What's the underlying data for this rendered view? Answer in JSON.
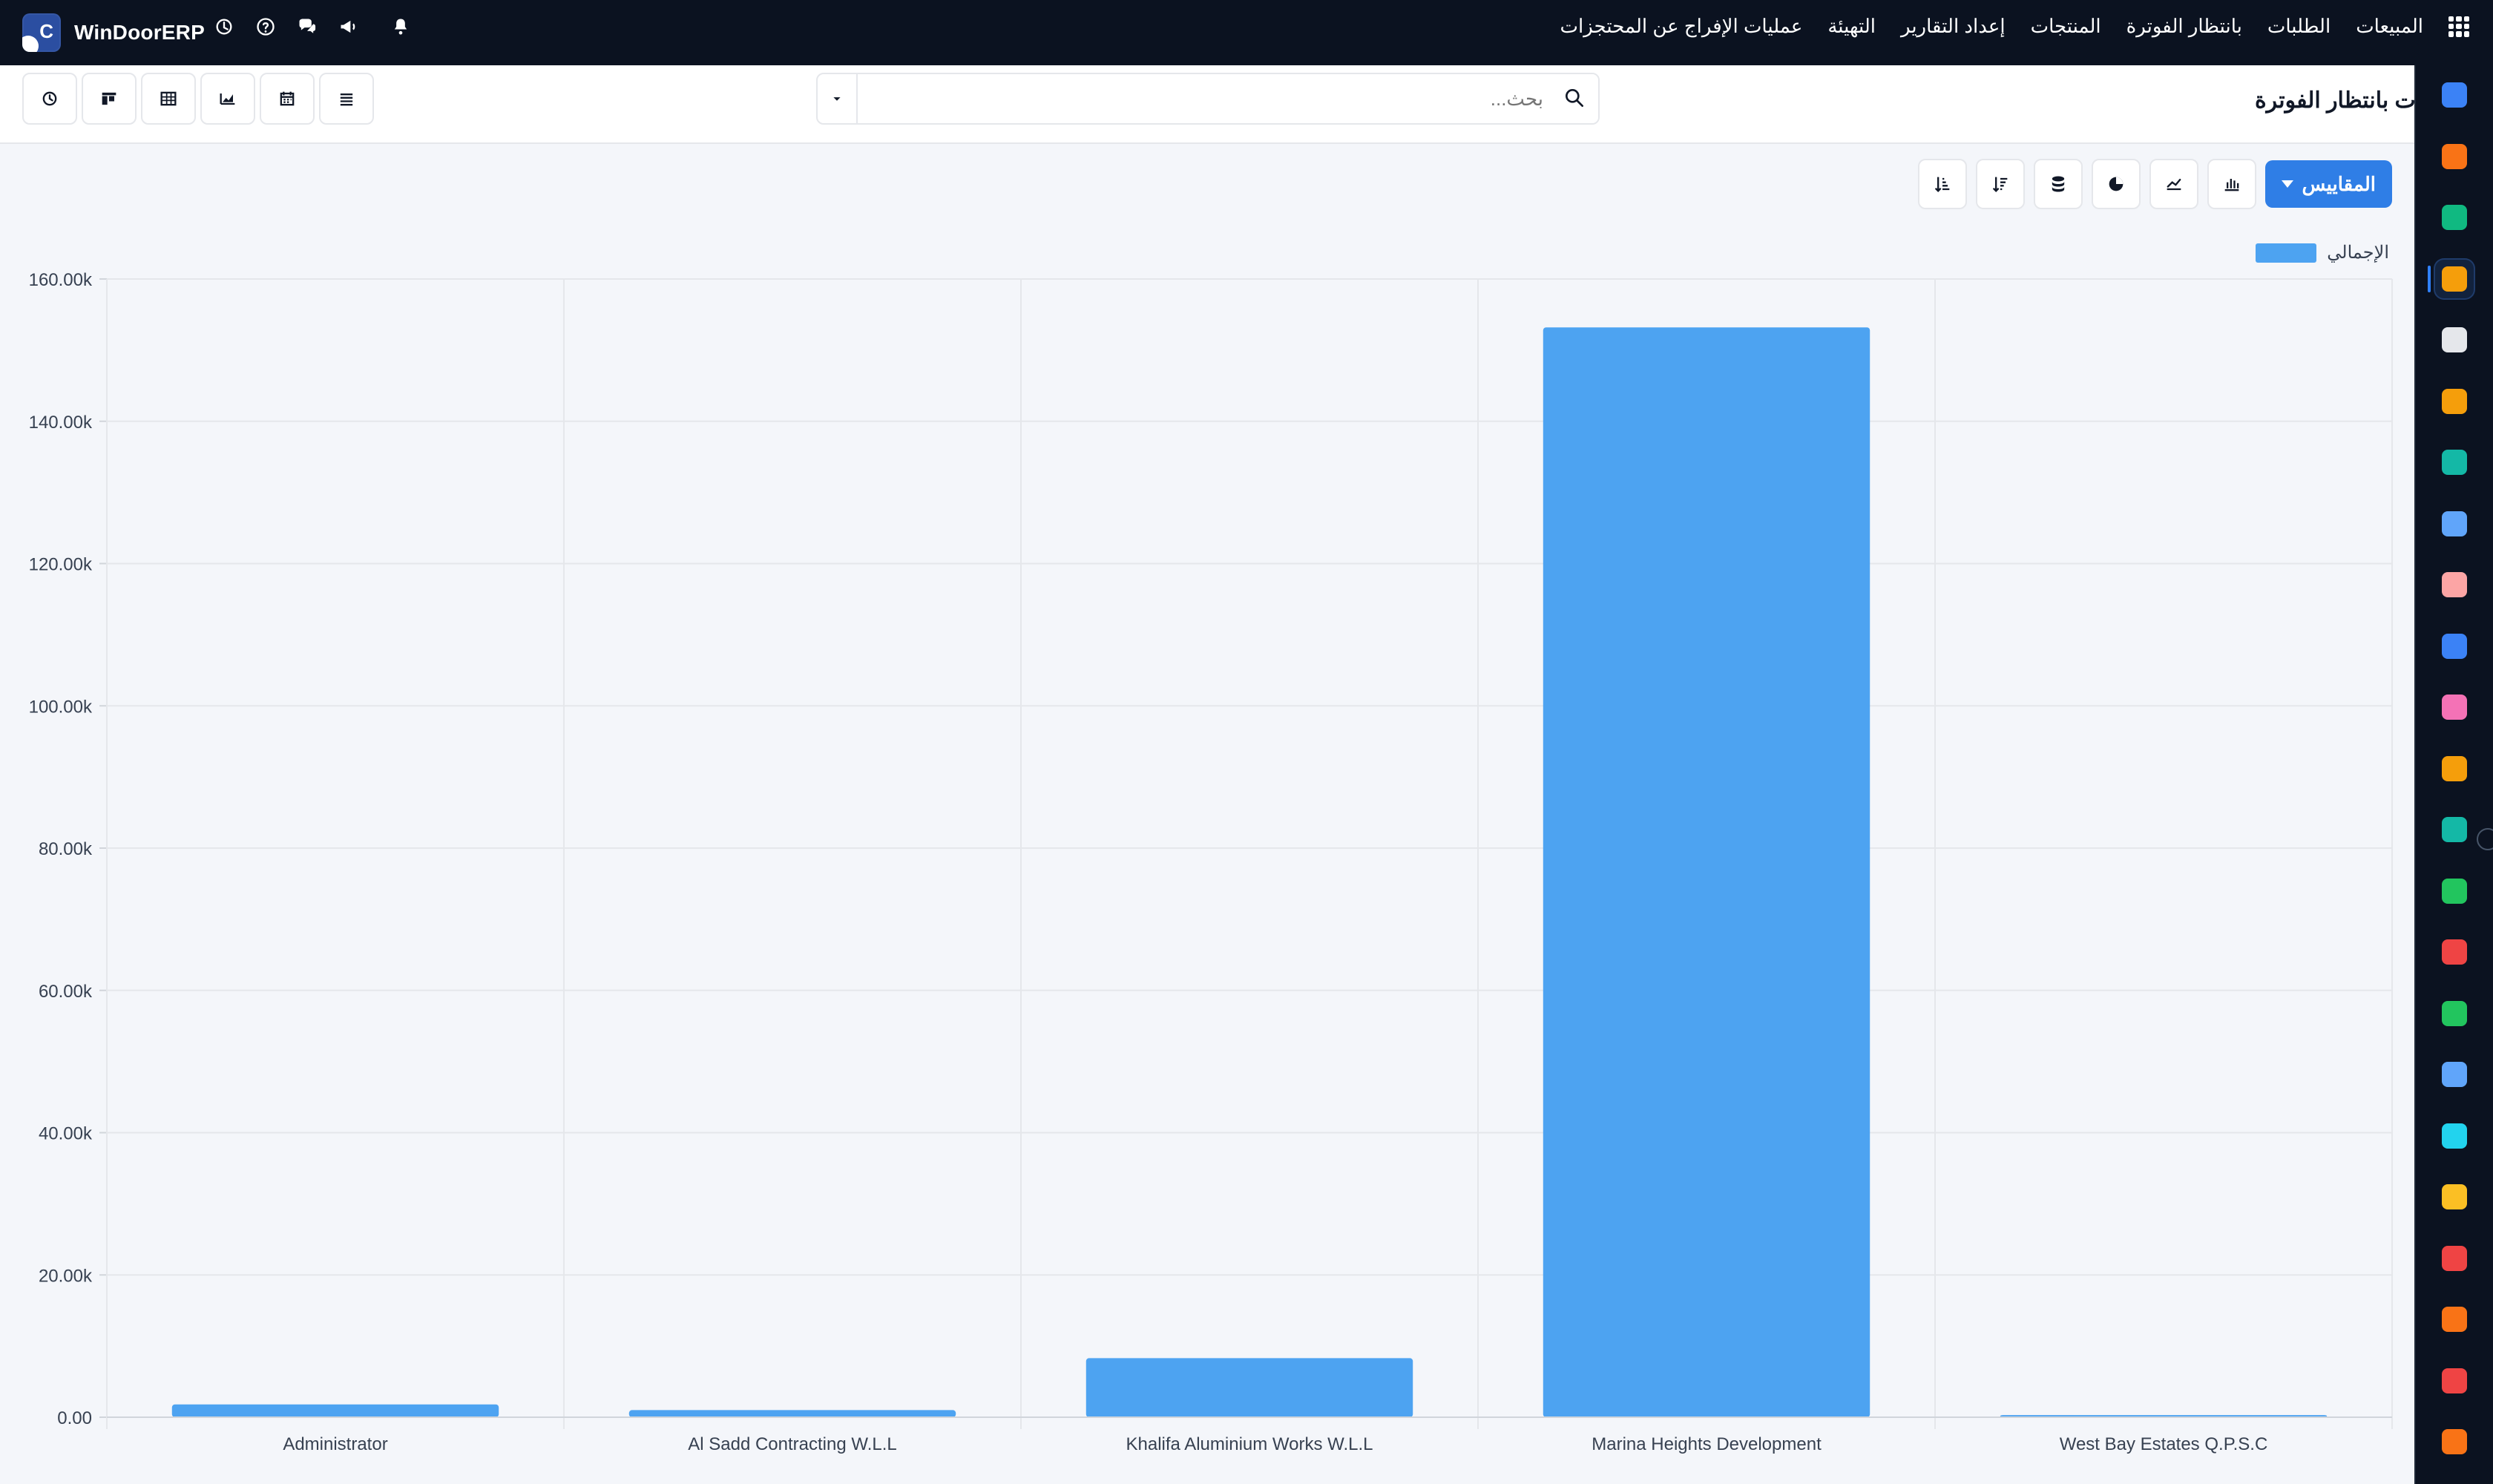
{
  "topbar": {
    "brand_title": "WinDoorERP",
    "icons": [
      "clock-icon",
      "help-icon",
      "chat-icon",
      "megaphone-icon",
      "bell-icon"
    ],
    "apps_icon": "apps-grid-icon",
    "nav": [
      {
        "label": "المبيعات"
      },
      {
        "label": "الطلبات"
      },
      {
        "label": "بانتظار الفوترة"
      },
      {
        "label": "المنتجات"
      },
      {
        "label": "إعداد التقارير"
      },
      {
        "label": "التهيئة"
      },
      {
        "label": "عمليات الإفراج عن المحتجزات"
      }
    ]
  },
  "subbar": {
    "page_title": "الطلبات بانتظار الفوترة",
    "search_placeholder": "بحث...",
    "views": [
      "activity-icon",
      "kanban-icon",
      "pivot-icon",
      "graph-icon",
      "calendar-icon",
      "list-icon"
    ]
  },
  "toolbar": {
    "measures_label": "المقاييس",
    "buttons": [
      "bar-chart-icon",
      "line-chart-icon",
      "pie-chart-icon",
      "stacked-icon",
      "sort-desc-icon",
      "sort-asc-icon"
    ]
  },
  "legend": {
    "label": "الإجمالي",
    "color": "#4da3f1"
  },
  "rail": [
    {
      "name": "mail-app-icon",
      "color": "#3b82f6"
    },
    {
      "name": "discuss-app-icon",
      "color": "#f97316"
    },
    {
      "name": "inventory-app-icon",
      "color": "#10b981"
    },
    {
      "name": "reporting-app-icon",
      "color": "#f59e0b"
    },
    {
      "name": "products-app-icon",
      "color": "#e5e7eb"
    },
    {
      "name": "contacts-app-icon",
      "color": "#f59e0b"
    },
    {
      "name": "tasks-app-icon",
      "color": "#14b8a6"
    },
    {
      "name": "knowledge-app-icon",
      "color": "#60a5fa"
    },
    {
      "name": "package-app-icon",
      "color": "#fca5a5"
    },
    {
      "name": "invoice-app-icon",
      "color": "#3b82f6"
    },
    {
      "name": "employees-app-icon",
      "color": "#f472b6"
    },
    {
      "name": "calendar-app-icon",
      "color": "#f59e0b"
    },
    {
      "name": "sign-app-icon",
      "color": "#14b8a6"
    },
    {
      "name": "contacts-card-app-icon",
      "color": "#22c55e"
    },
    {
      "name": "dashboard-app-icon",
      "color": "#ef4444"
    },
    {
      "name": "whatsapp-app-icon",
      "color": "#22c55e"
    },
    {
      "name": "timer-app-icon",
      "color": "#60a5fa"
    },
    {
      "name": "website-app-icon",
      "color": "#22d3ee"
    },
    {
      "name": "telegram-app-icon",
      "color": "#fbbf24"
    },
    {
      "name": "banking-app-icon",
      "color": "#ef4444"
    },
    {
      "name": "manufacturing-app-icon",
      "color": "#f97316"
    },
    {
      "name": "settings-app-icon",
      "color": "#ef4444"
    },
    {
      "name": "discovery-app-icon",
      "color": "#f97316"
    }
  ],
  "chart_data": {
    "type": "bar",
    "categories": [
      "Administrator",
      "Al Sadd Contracting W.L.L",
      "Khalifa Aluminium Works W.L.L",
      "Marina Heights Development",
      "West Bay Estates Q.P.S.C"
    ],
    "series": [
      {
        "name": "الإجمالي",
        "values": [
          1800,
          1000,
          8300,
          153200,
          300
        ],
        "color": "#4da3f1"
      }
    ],
    "ylim": [
      0,
      160000
    ],
    "yticks": [
      0,
      20000,
      40000,
      60000,
      80000,
      100000,
      120000,
      140000,
      160000
    ],
    "ytick_labels": [
      "0.00",
      "20.00k",
      "40.00k",
      "60.00k",
      "80.00k",
      "100.00k",
      "120.00k",
      "140.00k",
      "160.00k"
    ],
    "grid": true,
    "legend": "top-right"
  }
}
